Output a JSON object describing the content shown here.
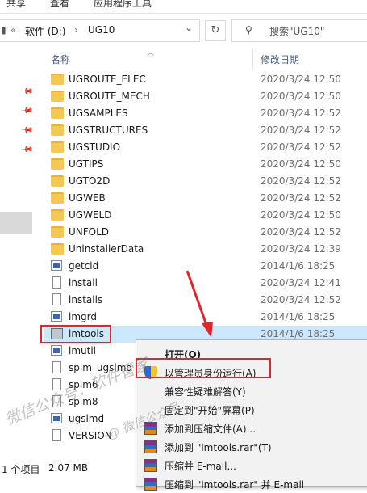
{
  "ribbon": {
    "tabs": [
      "共享",
      "查看",
      "应用程序工具"
    ]
  },
  "address": {
    "overflow": "«",
    "drive": "软件 (D:)",
    "sep": "›",
    "folder": "UG10",
    "dropdown": "⌄",
    "refresh": "↻"
  },
  "search": {
    "placeholder": "搜索\"UG10\""
  },
  "columns": {
    "name": "名称",
    "date": "修改日期"
  },
  "files": [
    {
      "name": "UGROUTE_ELEC",
      "date": "2020/3/24 12:50",
      "kind": "folder"
    },
    {
      "name": "UGROUTE_MECH",
      "date": "2020/3/24 12:50",
      "kind": "folder"
    },
    {
      "name": "UGSAMPLES",
      "date": "2020/3/24 12:52",
      "kind": "folder"
    },
    {
      "name": "UGSTRUCTURES",
      "date": "2020/3/24 12:52",
      "kind": "folder"
    },
    {
      "name": "UGSTUDIO",
      "date": "2020/3/24 12:52",
      "kind": "folder"
    },
    {
      "name": "UGTIPS",
      "date": "2020/3/24 12:50",
      "kind": "folder"
    },
    {
      "name": "UGTO2D",
      "date": "2020/3/24 12:52",
      "kind": "folder"
    },
    {
      "name": "UGWEB",
      "date": "2020/3/24 12:52",
      "kind": "folder"
    },
    {
      "name": "UGWELD",
      "date": "2020/3/24 12:50",
      "kind": "folder"
    },
    {
      "name": "UNFOLD",
      "date": "2020/3/24 12:52",
      "kind": "folder"
    },
    {
      "name": "UninstallerData",
      "date": "2020/3/24 12:39",
      "kind": "folder"
    },
    {
      "name": "getcid",
      "date": "2014/1/6 18:25",
      "kind": "exe"
    },
    {
      "name": "install",
      "date": "2020/3/24 12:41",
      "kind": "doc"
    },
    {
      "name": "installs",
      "date": "2020/3/24 12:52",
      "kind": "doc"
    },
    {
      "name": "lmgrd",
      "date": "2014/1/6 18:25",
      "kind": "exe"
    },
    {
      "name": "lmtools",
      "date": "2014/1/6 18:25",
      "kind": "tool"
    },
    {
      "name": "lmutil",
      "date": "",
      "kind": "exe"
    },
    {
      "name": "splm_ugslmd",
      "date": "",
      "kind": "doc"
    },
    {
      "name": "splm6",
      "date": "",
      "kind": "doc"
    },
    {
      "name": "splm8",
      "date": "",
      "kind": "doc"
    },
    {
      "name": "ugslmd",
      "date": "",
      "kind": "exe"
    },
    {
      "name": "VERSION",
      "date": "",
      "kind": "doc"
    }
  ],
  "status": {
    "count": "1 个项目",
    "size": "2.07 MB"
  },
  "context_menu": [
    {
      "label": "打开(O)",
      "icon": "none",
      "bold": true
    },
    {
      "label": "以管理员身份运行(A)",
      "icon": "shield-icon",
      "bold": false
    },
    {
      "label": "兼容性疑难解答(Y)",
      "icon": "none",
      "bold": false
    },
    {
      "label": "固定到\"开始\"屏幕(P)",
      "icon": "none",
      "bold": false
    },
    {
      "label": "添加到压缩文件(A)...",
      "icon": "rar-icon",
      "bold": false
    },
    {
      "label": "添加到 \"lmtools.rar\"(T)",
      "icon": "rar-icon",
      "bold": false
    },
    {
      "label": "压缩并 E-mail...",
      "icon": "rar-icon",
      "bold": false
    },
    {
      "label": "压缩到 \"lmtools.rar\" 并 E-mail",
      "icon": "rar-icon",
      "bold": false
    }
  ],
  "colors": {
    "selection": "#cce8ff",
    "highlight": "#e0262d",
    "folder": "#f3c854"
  }
}
